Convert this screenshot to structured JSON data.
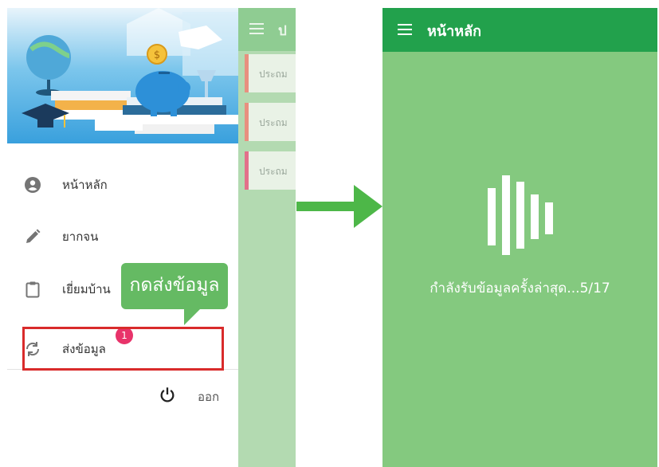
{
  "drawer": {
    "menu": [
      {
        "label": "หน้าหลัก",
        "icon": "account-circle-icon"
      },
      {
        "label": "ยากจน",
        "icon": "pencil-icon"
      },
      {
        "label": "เยี่ยมบ้าน",
        "icon": "clipboard-icon"
      },
      {
        "label": "ส่งข้อมูล",
        "icon": "sync-icon",
        "badge": "1"
      }
    ],
    "logout_label": "ออก",
    "callout_text": "กดส่งข้อมูล"
  },
  "background_screen": {
    "title": "ป",
    "cards": [
      {
        "text": "ประถม",
        "accent": "#e8907f"
      },
      {
        "text": "ประถม",
        "accent": "#e8907f"
      },
      {
        "text": "ประถม",
        "accent": "#e2708a"
      }
    ]
  },
  "right_screen": {
    "title": "หน้าหลัก",
    "status_text": "กำลังรับข้อมูลครั้งล่าสุด...5/17",
    "progress": {
      "current": 5,
      "total": 17
    }
  },
  "colors": {
    "app_bar": "#22a14c",
    "right_background": "#84c97f",
    "callout": "#65ba63",
    "highlight": "#d92b2b",
    "badge": "#e8336a",
    "arrow": "#4db748"
  }
}
